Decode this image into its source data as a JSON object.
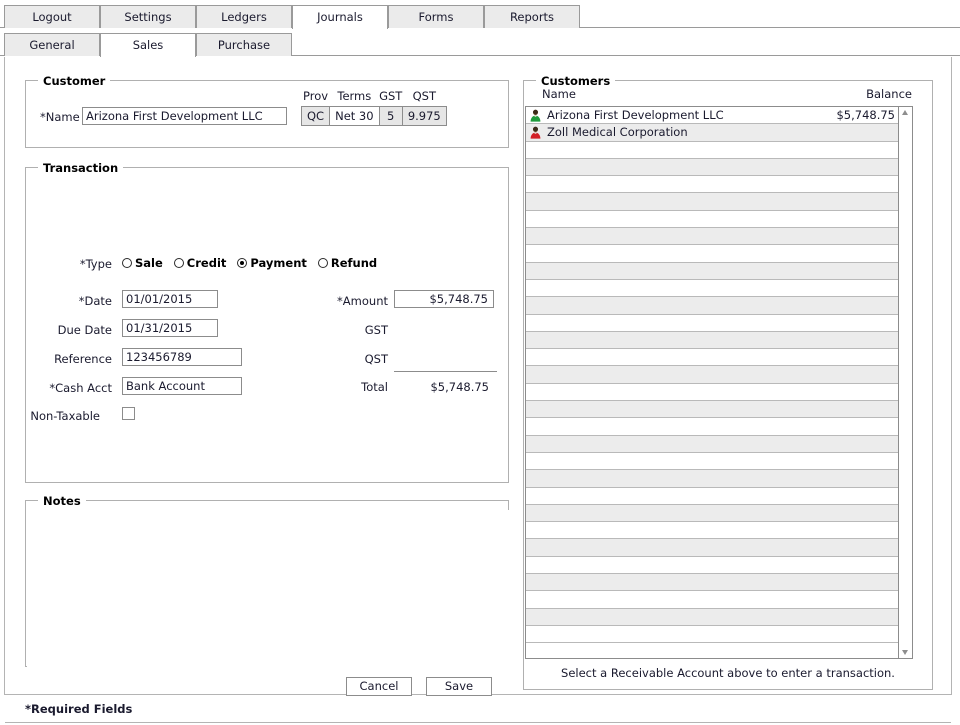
{
  "tabs": {
    "primary": [
      {
        "label": "Logout",
        "active": false
      },
      {
        "label": "Settings",
        "active": false
      },
      {
        "label": "Ledgers",
        "active": false
      },
      {
        "label": "Journals",
        "active": true
      },
      {
        "label": "Forms",
        "active": false
      },
      {
        "label": "Reports",
        "active": false
      }
    ],
    "secondary": [
      {
        "label": "General",
        "active": false
      },
      {
        "label": "Sales",
        "active": true
      },
      {
        "label": "Purchase",
        "active": false
      }
    ]
  },
  "customer": {
    "legend": "Customer",
    "name_label": "*Name",
    "name_value": "Arizona First Development LLC",
    "terms_headers": [
      "Prov",
      "Terms",
      "GST",
      "QST"
    ],
    "terms_values": [
      "QC",
      "Net 30",
      "5",
      "9.975"
    ]
  },
  "transaction": {
    "legend": "Transaction",
    "type_label": "*Type",
    "type_options": [
      {
        "label": "Sale",
        "selected": false
      },
      {
        "label": "Credit",
        "selected": false
      },
      {
        "label": "Payment",
        "selected": true
      },
      {
        "label": "Refund",
        "selected": false
      }
    ],
    "date_label": "*Date",
    "date_value": "01/01/2015",
    "due_date_label": "Due Date",
    "due_date_value": "01/31/2015",
    "reference_label": "Reference",
    "reference_value": "123456789",
    "cash_acct_label": "*Cash Acct",
    "cash_acct_value": "Bank Account",
    "non_taxable_label": "Non-Taxable",
    "non_taxable_checked": false,
    "amount_label": "*Amount",
    "amount_value": "$5,748.75",
    "gst_label": "GST",
    "gst_value": "",
    "qst_label": "QST",
    "qst_value": "",
    "total_label": "Total",
    "total_value": "$5,748.75"
  },
  "notes": {
    "legend": "Notes",
    "value": ""
  },
  "actions": {
    "cancel_label": "Cancel",
    "save_label": "Save",
    "required_note": "*Required Fields"
  },
  "customers_panel": {
    "legend": "Customers",
    "col_name": "Name",
    "col_balance": "Balance",
    "footer": "Select a Receivable Account above to enter a transaction.",
    "rows": [
      {
        "name": "Arizona First Development LLC",
        "balance": "$5,748.75",
        "icon": "person-icon-green",
        "icon_color": "#1f9c3c"
      },
      {
        "name": "Zoll Medical Corporation",
        "balance": "",
        "icon": "person-icon-red",
        "icon_color": "#d31f26"
      }
    ],
    "empty_row_count": 29,
    "scroll_up_icon": "scroll-up-arrow-icon",
    "scroll_down_icon": "scroll-down-arrow-icon"
  }
}
